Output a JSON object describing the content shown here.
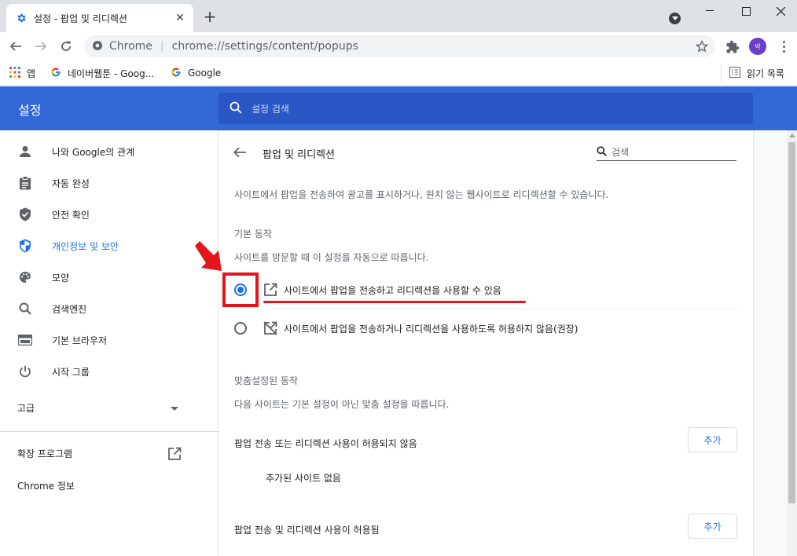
{
  "browser": {
    "tab_title": "설정 - 팝업 및 리디렉션",
    "new_tab_symbol": "+",
    "omnibox_site": "Chrome",
    "omnibox_separator": "|",
    "omnibox_url": "chrome://settings/content/popups",
    "profile_initial": "박",
    "bookmarks": [
      {
        "label": "앱",
        "icon": "apps-grid-icon"
      },
      {
        "label": "네이버웹툰 - Goog...",
        "icon": "google-g-icon"
      },
      {
        "label": "Google",
        "icon": "google-g-icon"
      }
    ],
    "reading_list": "읽기 목록"
  },
  "settings": {
    "title": "설정",
    "search_placeholder": "설정 검색",
    "sidebar": {
      "items": [
        {
          "label": "나와 Google의 관계",
          "icon": "person-icon",
          "active": false
        },
        {
          "label": "자동 완성",
          "icon": "clipboard-icon",
          "active": false
        },
        {
          "label": "안전 확인",
          "icon": "shield-check-icon",
          "active": false
        },
        {
          "label": "개인정보 및 보안",
          "icon": "security-shield-icon",
          "active": true
        },
        {
          "label": "모양",
          "icon": "palette-icon",
          "active": false
        },
        {
          "label": "검색엔진",
          "icon": "search-icon",
          "active": false
        },
        {
          "label": "기본 브라우저",
          "icon": "browser-window-icon",
          "active": false
        },
        {
          "label": "시작 그룹",
          "icon": "power-icon",
          "active": false
        }
      ],
      "advanced": "고급",
      "extensions": "확장 프로그램",
      "about": "Chrome 정보"
    },
    "page": {
      "title": "팝업 및 리디렉션",
      "search_placeholder": "검색",
      "description": "사이트에서 팝업을 전송하여 광고를 표시하거나, 원치 않는 웹사이트로 리디렉션할 수 있습니다.",
      "default_heading": "기본 동작",
      "default_sub": "사이트를 방문할 때 이 설정을 자동으로 따릅니다.",
      "option_allow": "사이트에서 팝업을 전송하고 리디렉션을 사용할 수 있음",
      "option_block": "사이트에서 팝업을 전송하거나 리디렉션을 사용하도록 허용하지 않음(권장)",
      "selected_option": "allow",
      "custom_heading": "맞춤설정된 동작",
      "custom_sub": "다음 사이트는 기본 설정이 아닌 맞춤 설정을 따릅니다.",
      "blocked_list_heading": "팝업 전송 또는 리디렉션 사용이 허용되지 않음",
      "allowed_list_heading": "팝업 전송 및 리디렉션 사용이 허용됨",
      "add_label": "추가",
      "empty_label": "추가된 사이트 없음"
    }
  },
  "colors": {
    "header_blue": "#3367d6",
    "accent_blue": "#1a73e8",
    "annotation_red": "#e3141b"
  }
}
